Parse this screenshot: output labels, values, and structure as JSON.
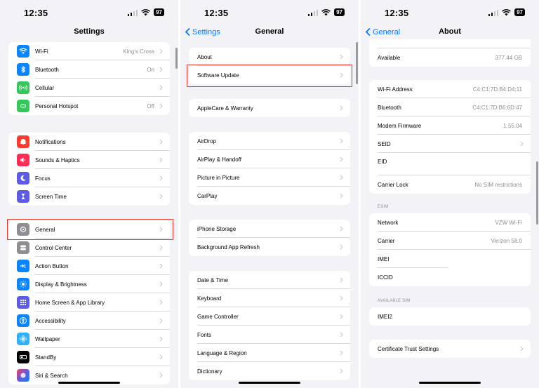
{
  "status": {
    "time": "12:35",
    "battery": "97"
  },
  "settings": {
    "title": "Settings",
    "group1": [
      {
        "label": "Wi-Fi",
        "value": "King's Cross",
        "icon": "wifi-icon",
        "color": "#0a84ff"
      },
      {
        "label": "Bluetooth",
        "value": "On",
        "icon": "bluetooth-icon",
        "color": "#0a84ff"
      },
      {
        "label": "Cellular",
        "value": "",
        "icon": "cellular-icon",
        "color": "#34c759"
      },
      {
        "label": "Personal Hotspot",
        "value": "Off",
        "icon": "hotspot-icon",
        "color": "#34c759"
      }
    ],
    "group2": [
      {
        "label": "Notifications",
        "icon": "bell-icon",
        "color": "#ff3b30"
      },
      {
        "label": "Sounds & Haptics",
        "icon": "speaker-icon",
        "color": "#ff2d55"
      },
      {
        "label": "Focus",
        "icon": "moon-icon",
        "color": "#5e5ce6"
      },
      {
        "label": "Screen Time",
        "icon": "hourglass-icon",
        "color": "#5e5ce6"
      }
    ],
    "group3": [
      {
        "label": "General",
        "icon": "gear-icon",
        "color": "#8e8e93"
      },
      {
        "label": "Control Center",
        "icon": "toggles-icon",
        "color": "#8e8e93"
      },
      {
        "label": "Action Button",
        "icon": "action-icon",
        "color": "#0a84ff"
      },
      {
        "label": "Display & Brightness",
        "icon": "sun-icon",
        "color": "#0a84ff"
      },
      {
        "label": "Home Screen & App Library",
        "icon": "grid-icon",
        "color": "#5e5ce6"
      },
      {
        "label": "Accessibility",
        "icon": "accessibility-icon",
        "color": "#0a84ff"
      },
      {
        "label": "Wallpaper",
        "icon": "flower-icon",
        "color": "#30b0ff"
      },
      {
        "label": "StandBy",
        "icon": "standby-icon",
        "color": "#000000"
      },
      {
        "label": "Siri & Search",
        "icon": "siri-icon",
        "color": "#333333"
      }
    ]
  },
  "general": {
    "title": "General",
    "back": "Settings",
    "group1": [
      "About",
      "Software Update"
    ],
    "group2": [
      "AppleCare & Warranty"
    ],
    "group3": [
      "AirDrop",
      "AirPlay & Handoff",
      "Picture in Picture",
      "CarPlay"
    ],
    "group4": [
      "iPhone Storage",
      "Background App Refresh"
    ],
    "group5": [
      "Date & Time",
      "Keyboard",
      "Game Controller",
      "Fonts",
      "Language & Region",
      "Dictionary"
    ]
  },
  "about": {
    "title": "About",
    "back": "General",
    "available": {
      "label": "Available",
      "value": "377.44 GB"
    },
    "group1": [
      {
        "label": "Wi-Fi Address",
        "value": "C4:C1:7D:B4:D4:11",
        "chevron": false
      },
      {
        "label": "Bluetooth",
        "value": "C4:C1:7D:B6:6D:47",
        "chevron": false
      },
      {
        "label": "Modem Firmware",
        "value": "1.55.04",
        "chevron": false
      },
      {
        "label": "SEID",
        "value": "",
        "chevron": true
      },
      {
        "label": "EID",
        "value": "",
        "chevron": false
      },
      {
        "label": "Carrier Lock",
        "value": "No SIM restrictions",
        "chevron": false
      }
    ],
    "esim_header": "ESIM",
    "esim": [
      {
        "label": "Network",
        "value": "VZW Wi-Fi"
      },
      {
        "label": "Carrier",
        "value": "Verizon 58.0"
      },
      {
        "label": "IMEI",
        "value": ""
      },
      {
        "label": "ICCID",
        "value": ""
      }
    ],
    "sim_header": "AVAILABLE SIM",
    "sim": [
      {
        "label": "IMEI2",
        "value": ""
      }
    ],
    "certificate": "Certificate Trust Settings"
  }
}
